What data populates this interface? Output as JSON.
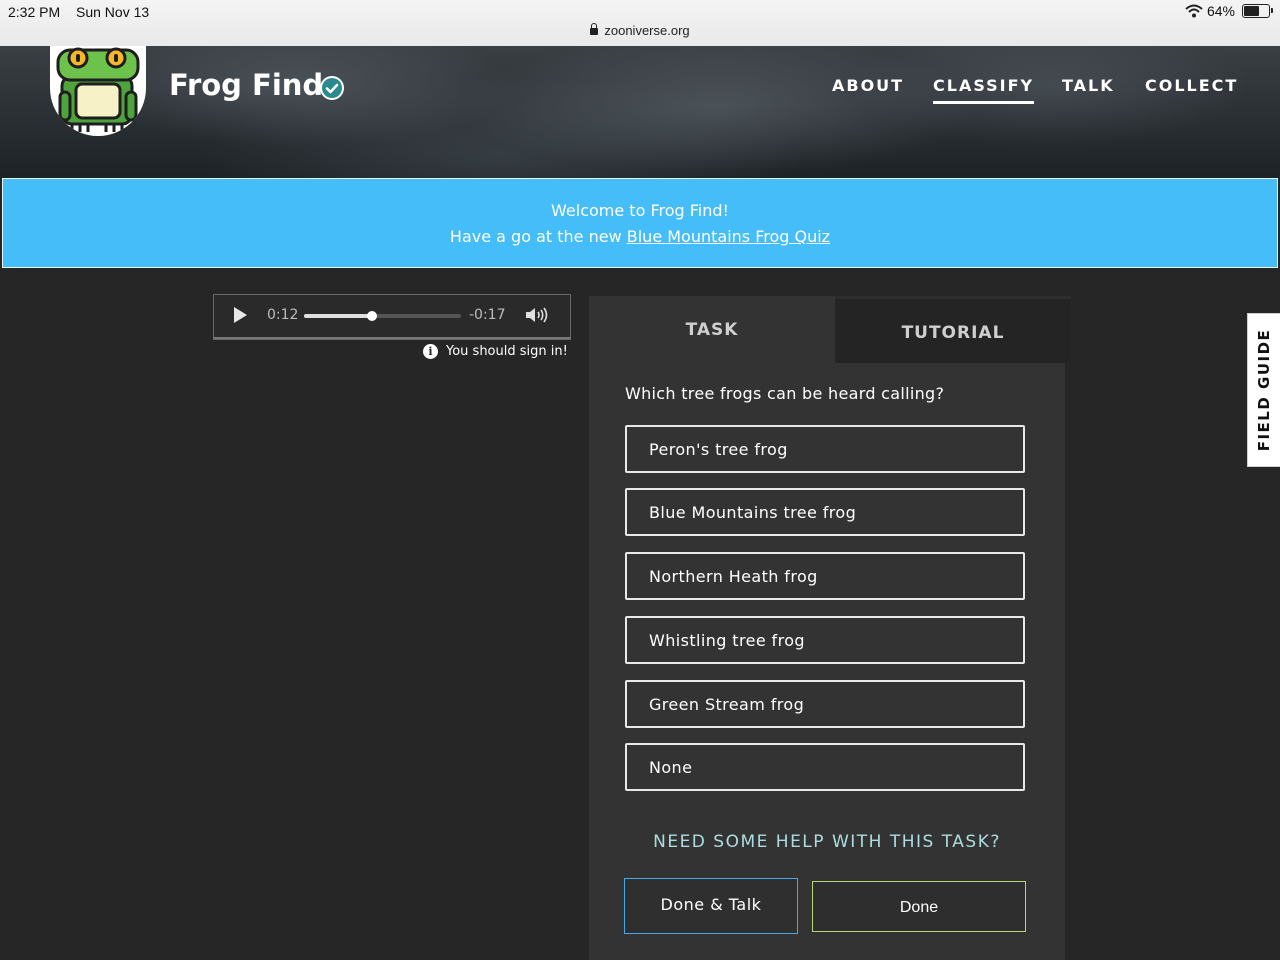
{
  "status_bar": {
    "time": "2:32 PM",
    "date": "Sun Nov 13",
    "url": "zooniverse.org",
    "battery": "64%",
    "battery_level": 0.64
  },
  "header": {
    "project_title": "Frog Find",
    "nav": [
      {
        "label": "ABOUT",
        "active": false
      },
      {
        "label": "CLASSIFY",
        "active": true
      },
      {
        "label": "TALK",
        "active": false
      },
      {
        "label": "COLLECT",
        "active": false
      }
    ]
  },
  "banner": {
    "line1": "Welcome to Frog Find!",
    "line2_prefix": "Have a go at the new ",
    "link_text": "Blue Mountains Frog Quiz",
    "background": "#45bdf8"
  },
  "audio": {
    "elapsed": "0:12",
    "remaining": "-0:17",
    "progress": 0.43
  },
  "signin_notice": "You should sign in!",
  "task_panel": {
    "tabs": [
      {
        "label": "TASK",
        "active": true
      },
      {
        "label": "TUTORIAL",
        "active": false
      }
    ],
    "question": "Which tree frogs can be heard calling?",
    "answers": [
      "Peron's tree frog",
      "Blue Mountains tree frog",
      "Northern Heath frog",
      "Whistling tree frog",
      "Green Stream frog",
      "None"
    ],
    "help_link": "NEED SOME HELP WITH THIS TASK?",
    "done_talk_label": "Done & Talk",
    "done_label": "Done"
  },
  "field_guide_label": "FIELD GUIDE",
  "colors": {
    "background": "#262626",
    "panel": "#333333",
    "help_link": "#addde0",
    "done_talk_border": "#45a8e8",
    "done_border": "#b6d67a"
  }
}
